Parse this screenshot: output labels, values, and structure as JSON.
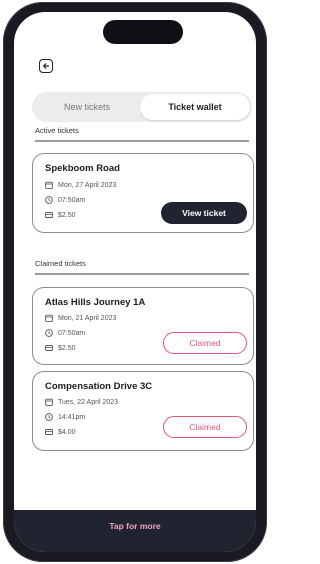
{
  "header": {
    "back_icon": "back-arrow-icon"
  },
  "tabs": [
    {
      "label": "New tickets",
      "active": false
    },
    {
      "label": "Ticket wallet",
      "active": true
    }
  ],
  "active_section": {
    "label": "Active tickets",
    "tickets": [
      {
        "title": "Spekboom Road",
        "date": "Mon, 27 April 2023",
        "time": "07:50am",
        "price": "$2.50",
        "action": "View ticket"
      }
    ]
  },
  "claimed_section": {
    "label": "Claimed tickets",
    "tickets": [
      {
        "title": "Atlas Hills Journey 1A",
        "date": "Mon, 21 April 2023",
        "time": "07:50am",
        "price": "$2.50",
        "status": "Claimed"
      },
      {
        "title": "Compensation Drive 3C",
        "date": "Tues, 22 April 2023",
        "time": "14:41pm",
        "price": "$4.00",
        "status": "Claimed"
      }
    ]
  },
  "footer": {
    "label": "Tap for more"
  },
  "colors": {
    "dark": "#1f2430",
    "accent_pink": "#e0567a",
    "footer_text": "#f3a3c3"
  }
}
